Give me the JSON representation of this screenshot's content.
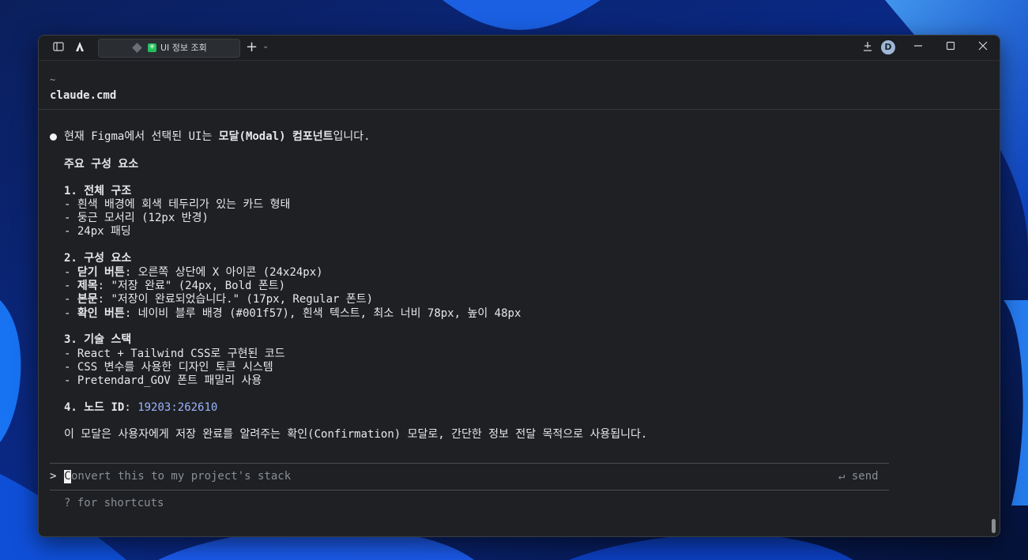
{
  "titlebar": {
    "tab_label": "UI 정보 조회",
    "new_tab_symbol": "+",
    "avatar_initial": "D",
    "icons": [
      "sidebar-toggle-icon",
      "app-logo-icon",
      "tab-diamond-icon",
      "tab-badge-icon",
      "new-tab-plus-icon",
      "chevron-down-icon",
      "pin-icon",
      "minimize-icon",
      "maximize-icon",
      "close-icon"
    ]
  },
  "path": {
    "tilde": "~",
    "name": "claude.cmd"
  },
  "response": {
    "intro": {
      "a": "현재 Figma에서 선택된 UI는 ",
      "b": "모달(Modal) 컴포넌트",
      "c": "입니다."
    },
    "heading": "주요 구성 요소",
    "s1_title": "1. 전체 구조",
    "s1_items": [
      "- 흰색 배경에 회색 테두리가 있는 카드 형태",
      "- 둥근 모서리 (12px 반경)",
      "- 24px 패딩"
    ],
    "s2_title": "2. 구성 요소",
    "s2_items": [
      {
        "dash": "- ",
        "key": "닫기 버튼",
        "val": ": 오른쪽 상단에 X 아이콘 (24x24px)"
      },
      {
        "dash": "- ",
        "key": "제목",
        "val": ": \"저장 완료\" (24px, Bold 폰트)"
      },
      {
        "dash": "- ",
        "key": "본문",
        "val": ": \"저장이 완료되었습니다.\" (17px, Regular 폰트)"
      },
      {
        "dash": "- ",
        "key": "확인 버튼",
        "val": ": 네이비 블루 배경 (#001f57), 흰색 텍스트, 최소 너비 78px, 높이 48px"
      }
    ],
    "s3_title": "3. 기술 스택",
    "s3_items": [
      "- React + Tailwind CSS로 구현된 코드",
      "- CSS 변수를 사용한 디자인 토큰 시스템",
      "- Pretendard_GOV 폰트 패밀리 사용"
    ],
    "s4_title": "4. 노드 ID",
    "s4_colon": ": ",
    "node_id": "19203:262610",
    "conclusion": "이 모달은 사용자에게 저장 완료를 알려주는 확인(Confirmation) 모달로, 간단한 정보 전달 목적으로 사용됩니다."
  },
  "input": {
    "prompt_symbol": ">",
    "cursor_char": "C",
    "placeholder_rest": "onvert this to my project's stack",
    "send_label": "↵ send"
  },
  "footer": {
    "shortcuts_hint": "? for shortcuts"
  }
}
